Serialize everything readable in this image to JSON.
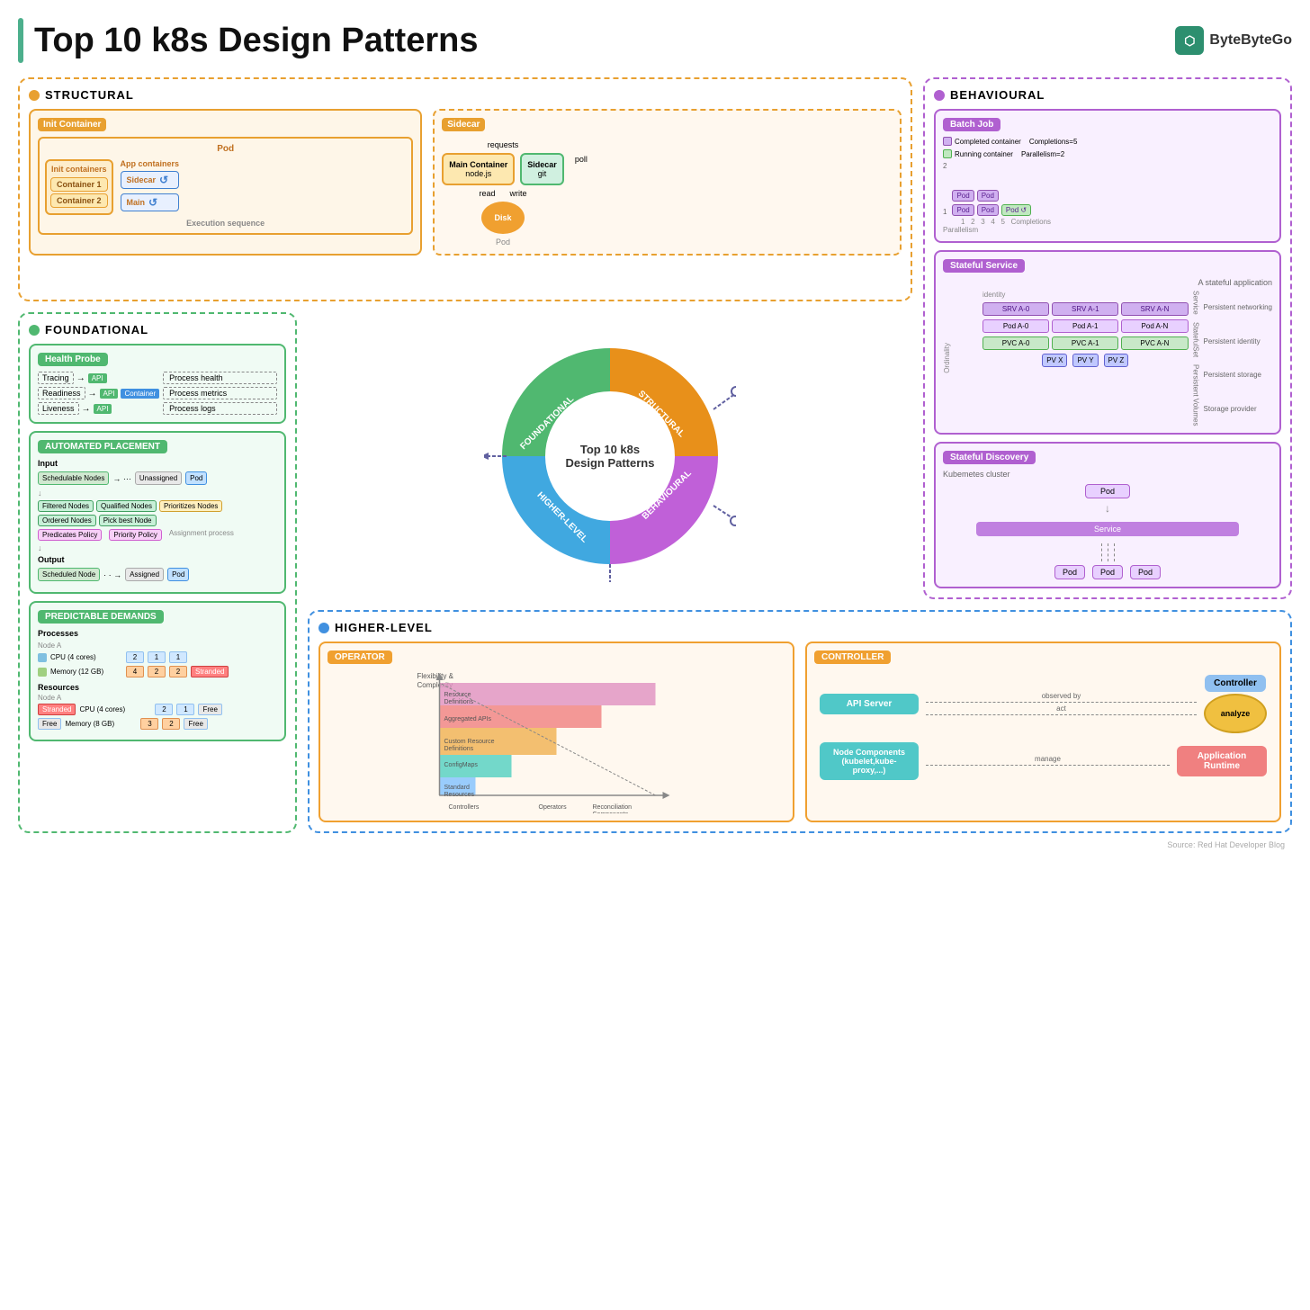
{
  "page": {
    "title": "Top 10 k8s Design Patterns",
    "source": "Source: Red Hat Developer Blog",
    "logo_text": "ByteByteGo"
  },
  "structural": {
    "label": "STRUCTURAL",
    "init_container": {
      "label": "Init Container",
      "pod_label": "Pod",
      "app_containers": "App containers",
      "init_containers": "Init containers",
      "container1": "Container 1",
      "container2": "Container 2",
      "sidecar": "Sidecar",
      "main": "Main",
      "execution_label": "Execution sequence"
    },
    "sidecar": {
      "label": "Sidecar",
      "main_container": "Main Container",
      "node_js": "node.js",
      "sidecar": "Sidecar",
      "git": "git",
      "requests": "requests",
      "poll": "poll",
      "read": "read",
      "write": "write",
      "disk": "Disk",
      "pod_label": "Pod"
    }
  },
  "behavioural": {
    "label": "BEHAVIOURAL",
    "batch_job": {
      "label": "Batch Job",
      "parallelism": "Parallelism",
      "completions": "Completions",
      "completed_container": "Completed container",
      "running_container": "Running container",
      "parallelism_value": "Parallelism=2",
      "completions_value": "Completions=5"
    },
    "stateful_service": {
      "label": "Stateful Service",
      "title": "A stateful application",
      "identity": "identity",
      "ordinality": "Ordinality",
      "service": "Service",
      "stateful_set": "StatefulSet",
      "persistent_volumes": "Persistent Volumes",
      "persistent_networking": "Persistent networking",
      "persistent_identity": "Persistent identity",
      "persistent_storage": "Persistent storage",
      "storage_provider": "Storage provider",
      "srv_cells": [
        "SRV A-0",
        "SRV A-1",
        "SRV A-N"
      ],
      "pod_cells": [
        "Pod A-0",
        "Pod A-1",
        "Pod A-N"
      ],
      "pvc_cells": [
        "PVC A-0",
        "PVC A-1",
        "PVC A-N"
      ],
      "pv_cells": [
        "PV X",
        "PV Y",
        "PV Z"
      ]
    },
    "stateful_discovery": {
      "label": "Stateful Discovery",
      "kubernetes_cluster": "Kubemetes cluster",
      "pod": "Pod",
      "service": "Service",
      "pod1": "Pod",
      "pod2": "Pod",
      "pod3": "Pod"
    }
  },
  "foundational": {
    "label": "FOUNDATIONAL",
    "health_probe": {
      "label": "Health Probe",
      "tracing": "Tracing",
      "readiness": "Readiness",
      "liveness": "Liveness",
      "api": "API",
      "container": "Container",
      "process_health": "Process health",
      "process_metrics": "Process metrics",
      "process_logs": "Process logs"
    },
    "automated_placement": {
      "label": "AUTOMATED PLACEMENT",
      "input": "Input",
      "schedulable_nodes": "Schedulable Nodes",
      "unassigned": "Unassigned",
      "pod": "Pod",
      "filtered_nodes": "Filtered Nodes",
      "qualified_nodes": "Qualified Nodes",
      "prioritized_nodes": "Prioritizes Nodes",
      "ordered_nodes": "Ordered Nodes",
      "pick_best_node": "Pick best Node",
      "predicates_policy": "Predicates Policy",
      "priority_policy": "Priority Policy",
      "assignment_process": "Assignment process",
      "output": "Output",
      "scheduled_node": "Scheduled Node",
      "assigned": "Assigned"
    },
    "predictable_demands": {
      "label": "PREDICTABLE DEMANDS",
      "processes": "Processes",
      "resources": "Resources",
      "node_a": "Node A",
      "cpu_4cores": "CPU (4 cores)",
      "memory_12gb": "Memory (12 GB)",
      "cpu_4cores2": "CPU (4 cores)",
      "memory_8gb": "Memory (8 GB)",
      "stranded": "Stranded",
      "free": "Free",
      "values": [
        2,
        1,
        1,
        4,
        2,
        2,
        2,
        1,
        3,
        2
      ]
    }
  },
  "center_pie": {
    "center_text": "Top 10 k8s Design Patterns",
    "segments": [
      {
        "label": "STRUCTURAL",
        "color": "#e8901a"
      },
      {
        "label": "BEHAVIOURAL",
        "color": "#c060d8"
      },
      {
        "label": "HIGHER-LEVEL",
        "color": "#40a8e0"
      },
      {
        "label": "FOUNDATIONAL",
        "color": "#50b870"
      }
    ]
  },
  "higher_level": {
    "label": "HIGHER-LEVEL",
    "operator": {
      "label": "OPERATOR",
      "flexibility_complexity": "Flexibility & Complexity",
      "resource_definitions": "Resource Definitions",
      "aggregated_apis": "Aggregated APIs",
      "custom_resource_definitions": "Custom Resource Definitions",
      "configmaps": "ConfigMaps",
      "standard_resources": "Standard Resources",
      "reconciliation_components": "Reconciliation Components",
      "controllers": "Controllers",
      "operators": "Operators"
    },
    "controller": {
      "label": "CONTROLLER",
      "api_server": "API Server",
      "observed_by": "observed by",
      "act": "act",
      "controller": "Controller",
      "analyze": "analyze",
      "node_components": "Node Components (kubelet,kube-proxy,...)",
      "manage": "manage",
      "application_runtime": "Application Runtime"
    }
  }
}
